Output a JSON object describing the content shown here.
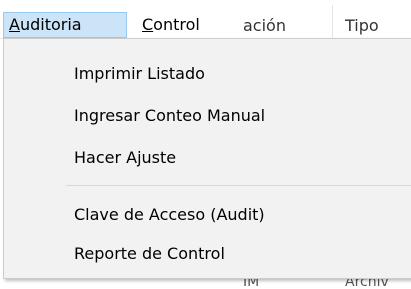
{
  "menubar": {
    "auditoria": {
      "mnemonic": "A",
      "rest": "uditoria"
    },
    "control": {
      "mnemonic": "C",
      "rest": "ontrol"
    }
  },
  "columns": [
    "ación",
    "Tipo"
  ],
  "dropdown": {
    "items": [
      "Imprimir Listado",
      "Ingresar Conteo Manual",
      "Hacer Ajuste",
      "Clave de Acceso (Audit)",
      "Reporte de Control"
    ]
  },
  "background_peek": [
    "IM",
    "Archiv"
  ]
}
